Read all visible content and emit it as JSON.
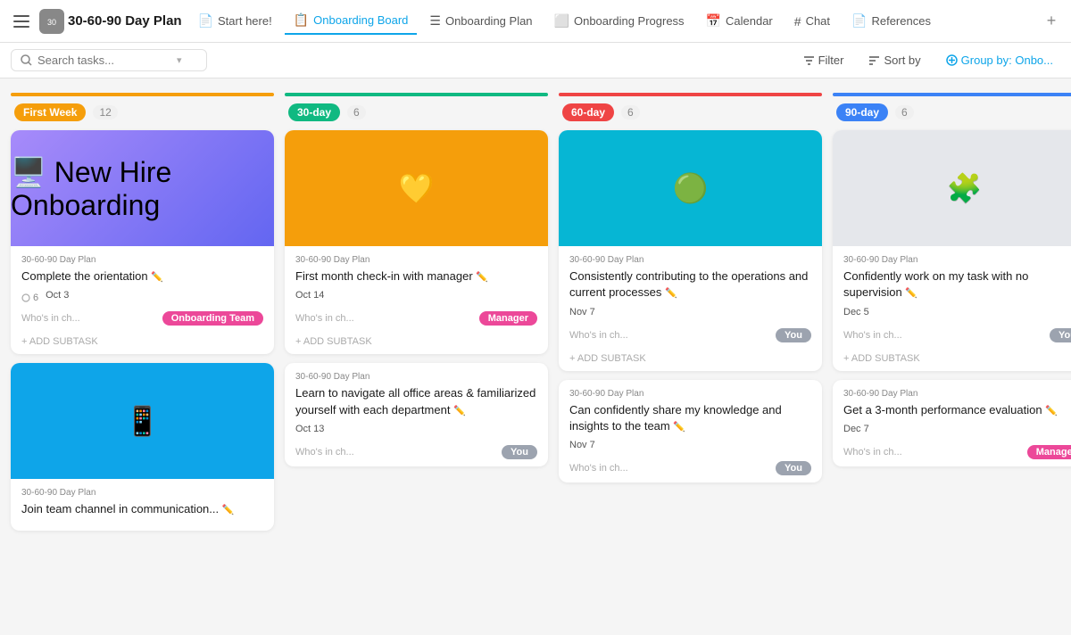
{
  "nav": {
    "app_icon": "🔵",
    "app_title": "30-60-90 Day Plan",
    "tabs": [
      {
        "id": "start",
        "label": "Start here!",
        "icon": "📄",
        "active": false
      },
      {
        "id": "onboarding-board",
        "label": "Onboarding Board",
        "icon": "📋",
        "active": true
      },
      {
        "id": "onboarding-plan",
        "label": "Onboarding Plan",
        "icon": "☰",
        "active": false
      },
      {
        "id": "onboarding-progress",
        "label": "Onboarding Progress",
        "icon": "⬜",
        "active": false
      },
      {
        "id": "calendar",
        "label": "Calendar",
        "icon": "📅",
        "active": false
      },
      {
        "id": "chat",
        "label": "Chat",
        "icon": "#",
        "active": false
      },
      {
        "id": "references",
        "label": "References",
        "icon": "📄",
        "active": false
      }
    ]
  },
  "toolbar": {
    "search_placeholder": "Search tasks...",
    "filter_label": "Filter",
    "sort_label": "Sort by",
    "group_label": "Group by: Onbo..."
  },
  "columns": [
    {
      "id": "first-week",
      "badge_label": "First Week",
      "badge_color": "#f59e0b",
      "count": "12",
      "accent": "col-first",
      "cards": [
        {
          "id": "c1",
          "has_image": true,
          "img_class": "img-onboarding",
          "img_text": "🖥️ New Hire Onboarding",
          "project": "30-60-90 Day Plan",
          "title": "Complete the orientation",
          "sub_count": "6",
          "date": "Oct 3",
          "who_label": "Who's in ch...",
          "assignee": "Onboarding Team",
          "assignee_color": "#ec4899",
          "add_subtask": "+ ADD SUBTASK"
        },
        {
          "id": "c2",
          "has_image": true,
          "img_class": "img-communication",
          "img_text": "📱",
          "project": "30-60-90 Day Plan",
          "title": "Join team channel in communication...",
          "sub_count": "",
          "date": "",
          "who_label": "",
          "assignee": "",
          "assignee_color": "",
          "add_subtask": ""
        }
      ]
    },
    {
      "id": "30-day",
      "badge_label": "30-day",
      "badge_color": "#10b981",
      "count": "6",
      "accent": "col-30",
      "cards": [
        {
          "id": "c3",
          "has_image": true,
          "img_class": "img-feelings",
          "img_text": "💛",
          "project": "30-60-90 Day Plan",
          "title": "First month check-in with manager",
          "sub_count": "",
          "date": "Oct 14",
          "who_label": "Who's in ch...",
          "assignee": "Manager",
          "assignee_color": "#ec4899",
          "add_subtask": "+ ADD SUBTASK"
        },
        {
          "id": "c4",
          "has_image": false,
          "img_class": "",
          "img_text": "",
          "project": "30-60-90 Day Plan",
          "title": "Learn to navigate all office areas & familiarized yourself with each department",
          "sub_count": "",
          "date": "Oct 13",
          "who_label": "Who's in ch...",
          "assignee": "You",
          "assignee_color": "#9ca3af",
          "add_subtask": ""
        }
      ]
    },
    {
      "id": "60-day",
      "badge_label": "60-day",
      "badge_color": "#ef4444",
      "count": "6",
      "accent": "col-60",
      "cards": [
        {
          "id": "c5",
          "has_image": true,
          "img_class": "img-continuous",
          "img_text": "🟢",
          "project": "30-60-90 Day Plan",
          "title": "Consistently contributing to the operations and current processes",
          "sub_count": "",
          "date": "Nov 7",
          "who_label": "Who's in ch...",
          "assignee": "You",
          "assignee_color": "#9ca3af",
          "add_subtask": "+ ADD SUBTASK"
        },
        {
          "id": "c6",
          "has_image": false,
          "img_class": "",
          "img_text": "",
          "project": "30-60-90 Day Plan",
          "title": "Can confidently share my knowledge and insights to the team",
          "sub_count": "",
          "date": "Nov 7",
          "who_label": "Who's in ch...",
          "assignee": "You",
          "assignee_color": "#9ca3af",
          "add_subtask": ""
        }
      ]
    },
    {
      "id": "90-day",
      "badge_label": "90-day",
      "badge_color": "#3b82f6",
      "count": "6",
      "accent": "col-90",
      "cards": [
        {
          "id": "c7",
          "has_image": true,
          "img_class": "img-independent",
          "img_text": "🧩",
          "project": "30-60-90 Day Plan",
          "title": "Confidently work on my task with no supervision",
          "sub_count": "",
          "date": "Dec 5",
          "who_label": "Who's in ch...",
          "assignee": "You",
          "assignee_color": "#9ca3af",
          "add_subtask": "+ ADD SUBTASK"
        },
        {
          "id": "c8",
          "has_image": false,
          "img_class": "",
          "img_text": "",
          "project": "30-60-90 Day Plan",
          "title": "Get a 3-month performance evaluation",
          "sub_count": "",
          "date": "Dec 7",
          "who_label": "Who's in ch...",
          "assignee": "Manager",
          "assignee_color": "#ec4899",
          "add_subtask": ""
        }
      ]
    }
  ]
}
